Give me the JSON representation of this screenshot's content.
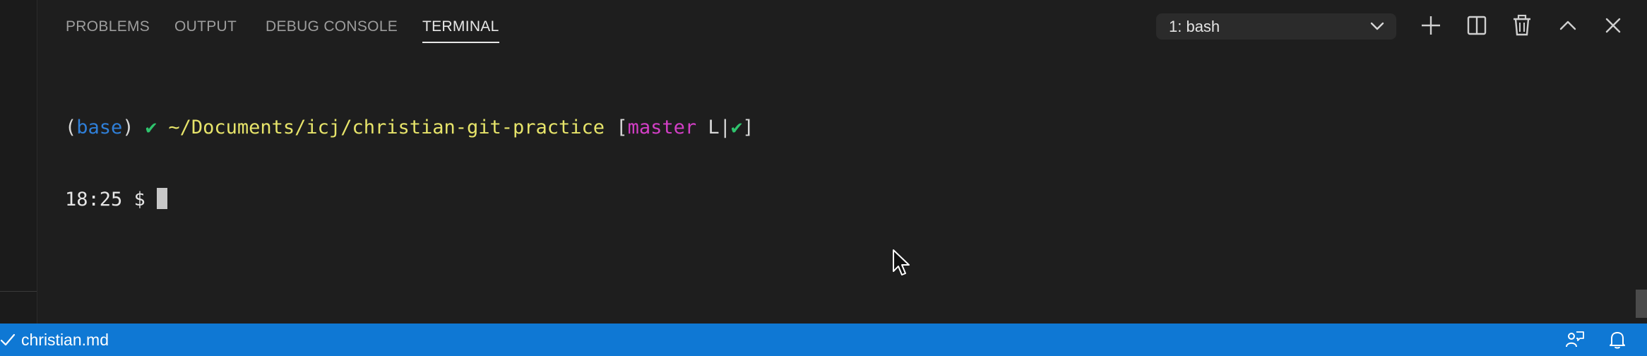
{
  "panel": {
    "tabs": [
      {
        "label": "PROBLEMS",
        "active": false
      },
      {
        "label": "OUTPUT",
        "active": false
      },
      {
        "label": "DEBUG CONSOLE",
        "active": false
      },
      {
        "label": "TERMINAL",
        "active": true
      }
    ],
    "terminal_select": {
      "value": "1: bash"
    },
    "toolbar": [
      "plus-icon",
      "split-icon",
      "trash-icon",
      "chevron-up-icon",
      "close-icon"
    ]
  },
  "terminal": {
    "line1": {
      "paren_open": "(",
      "env": "base",
      "paren_close": ")",
      "check": "✔",
      "path": "~/Documents/icj/christian-git-practice",
      "bracket_open": "[",
      "branch": "master",
      "status": "L|",
      "status_check": "✔",
      "bracket_close": "]"
    },
    "line2": {
      "time": "18:25",
      "prompt": "$"
    }
  },
  "statusbar": {
    "file": "christian.md",
    "icons": [
      "feedback-icon",
      "bell-icon"
    ]
  },
  "colors": {
    "statusbar_bg": "#0f78d4",
    "panel_bg": "#1e1e1e",
    "env_blue": "#2f7fd8",
    "check_green": "#2fc46d",
    "path_yellow": "#e7e46a",
    "branch_magenta": "#d33fc6"
  }
}
